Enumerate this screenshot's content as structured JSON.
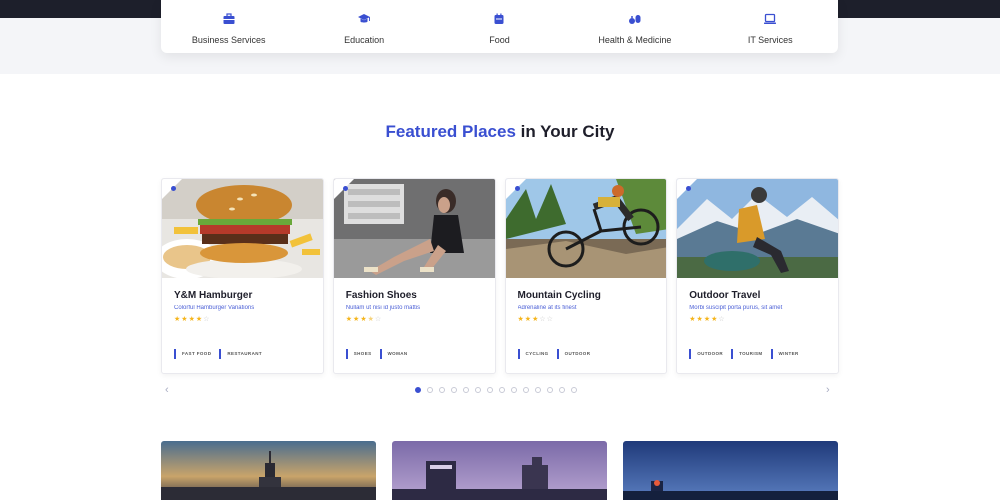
{
  "categories": [
    {
      "label": "Business Services",
      "icon": "briefcase-icon"
    },
    {
      "label": "Education",
      "icon": "graduation-cap-icon"
    },
    {
      "label": "Food",
      "icon": "food-icon"
    },
    {
      "label": "Health & Medicine",
      "icon": "medicine-icon"
    },
    {
      "label": "IT Services",
      "icon": "laptop-icon"
    }
  ],
  "featured": {
    "title_accent": "Featured Places",
    "title_rest": " in Your City"
  },
  "cards": [
    {
      "title": "Y&M Hamburger",
      "subtitle": "Colorful Hamburger Variations",
      "rating": 4,
      "rating_max": 5,
      "tags": [
        "FAST FOOD",
        "RESTAURANT"
      ],
      "image": "burger-photo"
    },
    {
      "title": "Fashion Shoes",
      "subtitle": "Nullam ut nisi id justo mattis",
      "rating": 3.5,
      "rating_max": 5,
      "tags": [
        "SHOES",
        "WOMAN"
      ],
      "image": "fashion-photo"
    },
    {
      "title": "Mountain Cycling",
      "subtitle": "Adrenaline at its finest",
      "rating": 3,
      "rating_max": 5,
      "tags": [
        "CYCLING",
        "OUTDOOR"
      ],
      "image": "cycling-photo"
    },
    {
      "title": "Outdoor Travel",
      "subtitle": "Morbi suscipit porta purus, sit amet",
      "rating": 4,
      "rating_max": 5,
      "tags": [
        "OUTDOOR",
        "TOURISM",
        "WINTER"
      ],
      "image": "mountain-photo"
    }
  ],
  "carousel": {
    "prev": "‹",
    "next": "›",
    "dots": 14,
    "active_dot": 0
  },
  "colors": {
    "accent": "#3a4fd1",
    "star": "#f5b51c",
    "dark": "#1e1e2a"
  }
}
